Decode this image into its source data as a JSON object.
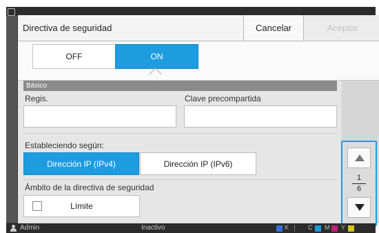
{
  "header": {
    "title": "Directiva de seguridad",
    "cancel_label": "Cancelar",
    "accept_label": "Aceptar"
  },
  "toggle": {
    "off_label": "OFF",
    "on_label": "ON",
    "selected": "ON"
  },
  "basic": {
    "section_label": "Básico",
    "regis_label": "Regis.",
    "regis_value": "",
    "psk_label": "Clave precompartida",
    "psk_value": ""
  },
  "establish": {
    "label": "Estableciendo según:",
    "options": [
      "Dirección IP (IPv4)",
      "Dirección IP (IPv6)"
    ],
    "selected": "Dirección IP (IPv4)"
  },
  "scope": {
    "label": "Ámbito de la directiva de seguridad",
    "limit_label": "Límite",
    "limit_checked": false
  },
  "pager": {
    "current": "1",
    "total": "6"
  },
  "status": {
    "user": "Admin",
    "state": "Inactivo",
    "inks": [
      "K",
      "C",
      "M",
      "Y"
    ]
  },
  "colors": {
    "accent": "#1d9ce0",
    "ink_k": "#3a6fd8",
    "ink_c": "#1a9ad6",
    "ink_m": "#c0207a",
    "ink_y": "#d6c21a"
  }
}
